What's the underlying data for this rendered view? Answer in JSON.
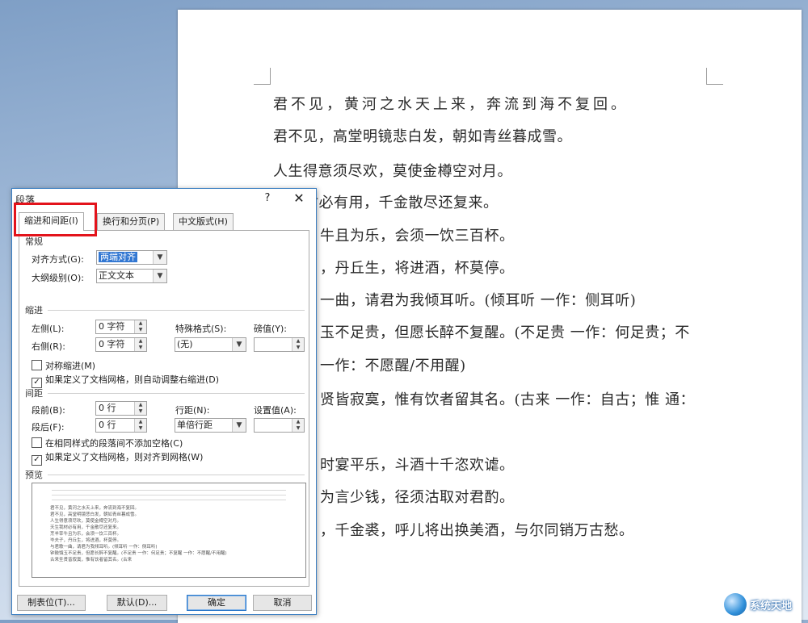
{
  "document": {
    "lines": [
      "君不见，黄河之水天上来，奔流到海不复回。",
      "君不见，高堂明镜悲白发，朝如青丝暮成雪。",
      "人生得意须尽欢，莫使金樽空对月。",
      "材必有用，千金散尽还复来。",
      "牛且为乐，会须一饮三百杯。",
      "，丹丘生，将进酒，杯莫停。",
      "一曲，请君为我倾耳听。(倾耳听 一作：侧耳听)",
      "玉不足贵，但愿长醉不复醒。(不足贵 一作：何足贵；不",
      "一作：不愿醒/不用醒)",
      "贤皆寂寞，惟有饮者留其名。(古来 一作：自古；惟 通：",
      "时宴平乐，斗酒十千恣欢谑。",
      "为言少钱，径须沽取对君酌。",
      "，千金裘，呼儿将出换美酒，与尔同销万古愁。"
    ]
  },
  "dialog": {
    "title": "段落",
    "help": "?",
    "close": "✕",
    "tabs": [
      "缩进和间距(I)",
      "换行和分页(P)",
      "中文版式(H)"
    ],
    "general": {
      "header": "常规",
      "align_label": "对齐方式(G):",
      "align_value": "两端对齐",
      "outline_label": "大纲级别(O):",
      "outline_value": "正文文本"
    },
    "indent": {
      "header": "缩进",
      "left_label": "左侧(L):",
      "left_value": "0 字符",
      "right_label": "右侧(R):",
      "right_value": "0 字符",
      "special_label": "特殊格式(S):",
      "special_value": "(无)",
      "by_label": "磅值(Y):",
      "by_value": "",
      "mirror_label": "对称缩进(M)",
      "mirror_checked": false,
      "auto_adjust_label": "如果定义了文档网格，则自动调整右缩进(D)",
      "auto_adjust_checked": true
    },
    "spacing": {
      "header": "间距",
      "before_label": "段前(B):",
      "before_value": "0 行",
      "after_label": "段后(F):",
      "after_value": "0 行",
      "line_label": "行距(N):",
      "line_value": "单倍行距",
      "at_label": "设置值(A):",
      "at_value": "",
      "no_space_label": "在相同样式的段落间不添加空格(C)",
      "no_space_checked": false,
      "snap_grid_label": "如果定义了文档网格，则对齐到网格(W)",
      "snap_grid_checked": true
    },
    "preview": {
      "header": "预览",
      "lines": [
        "君不见，黄河之水天上来，奔流到海不复回。",
        "君不见，高堂明镜悲白发，朝如青丝暮成雪。",
        "人生得意须尽欢，莫使金樽空对月。",
        "天生我材必有用，千金散尽还复来。",
        "烹羊宰牛且为乐，会须一饮三百杯。",
        "岑夫子，丹丘生，将进酒，杯莫停。",
        "与君歌一曲，请君为我倾耳听。(倾耳听 一作：侧耳听)",
        "钟鼓馔玉不足贵，但愿长醉不复醒。(不足贵 一作：何足贵；不复醒 一作：不愿醒/不用醒)",
        "古来圣贤皆寂寞，惟有饮者留其名。(古来"
      ]
    },
    "buttons": {
      "tabs": "制表位(T)...",
      "default": "默认(D)...",
      "ok": "确定",
      "cancel": "取消"
    }
  },
  "watermark": {
    "text": "系统天地"
  },
  "colors": {
    "highlight": "#e3131b",
    "selection": "#3277d2",
    "accent": "#3c7fc2"
  }
}
